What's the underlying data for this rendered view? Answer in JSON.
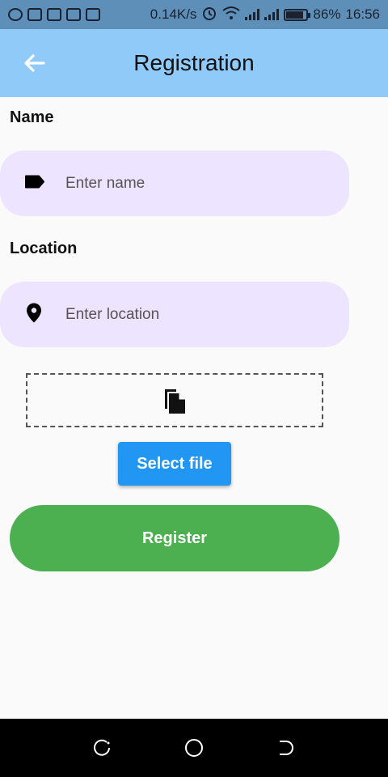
{
  "status_bar": {
    "speed": "0.14K/s",
    "battery": "86%",
    "battery_level": 0.86,
    "time": "16:56",
    "left_icons": [
      "whatsapp-icon",
      "tshirt-icon",
      "mail-icon",
      "image-icon",
      "lock-icon"
    ]
  },
  "app_bar": {
    "title": "Registration",
    "back_icon": "arrow-left-icon",
    "color": "#90caf9"
  },
  "form": {
    "name": {
      "label": "Name",
      "placeholder": "Enter name",
      "value": "",
      "icon": "label-tag-icon"
    },
    "location": {
      "label": "Location",
      "placeholder": "Enter location",
      "value": "",
      "icon": "location-pin-icon"
    },
    "file": {
      "icon": "file-copy-icon",
      "select_label": "Select file"
    },
    "register_label": "Register"
  },
  "colors": {
    "field_bg": "#ede4ff",
    "select_button": "#2196f3",
    "register_button": "#4caf50"
  },
  "nav_bar": {
    "buttons": [
      "recent-apps-icon",
      "home-icon",
      "back-icon"
    ]
  }
}
